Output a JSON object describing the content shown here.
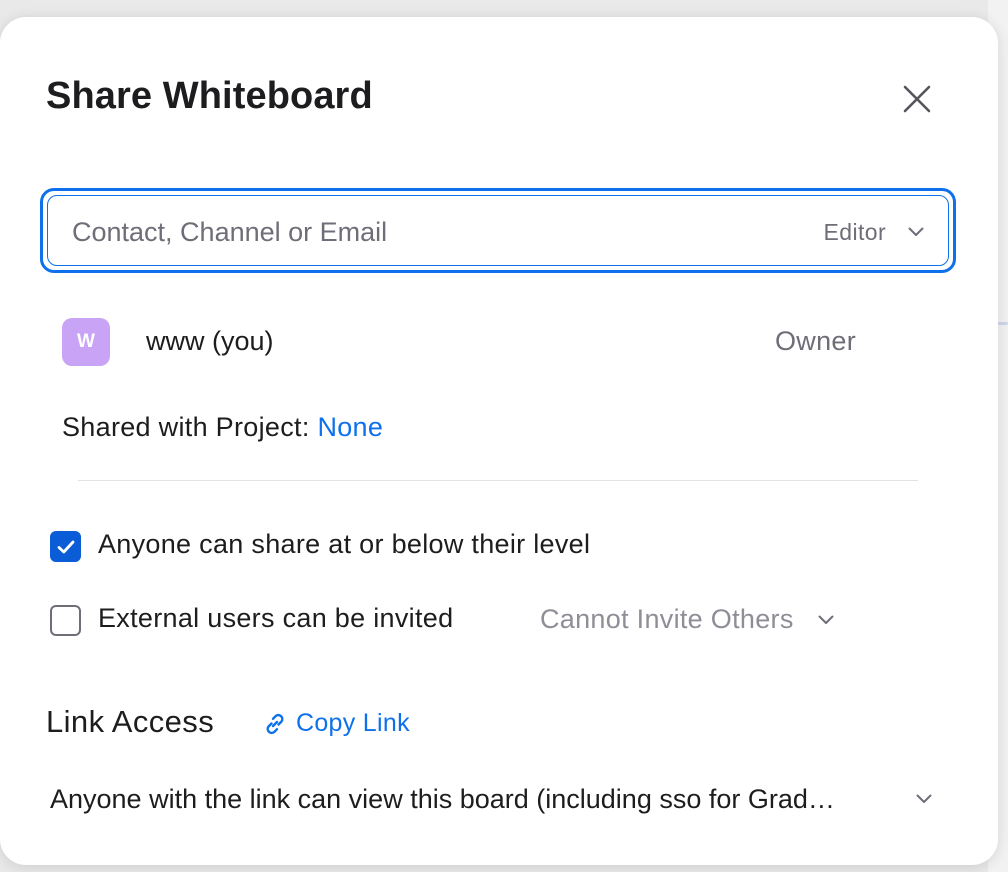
{
  "dialog": {
    "title": "Share Whiteboard",
    "close_icon": "close-icon"
  },
  "invite": {
    "placeholder": "Contact, Channel or Email",
    "value": "",
    "role": "Editor",
    "role_icon": "chevron-down-icon"
  },
  "members": [
    {
      "avatar_initial": "W",
      "avatar_color": "#c9a3f5",
      "name": "www (you)",
      "role": "Owner"
    }
  ],
  "project": {
    "label": "Shared with Project:",
    "value": "None"
  },
  "options": {
    "share_below_level": {
      "label": "Anyone can share at or below their level",
      "checked": true
    },
    "external_invite": {
      "label": "External users can be invited",
      "checked": false,
      "select_value": "Cannot Invite Others"
    }
  },
  "link_access": {
    "title": "Link Access",
    "copy_link_label": "Copy Link",
    "copy_link_icon": "link-icon",
    "selected": "Anyone with the link can view this board (including sso for Grad…"
  },
  "colors": {
    "accent": "#0e71eb",
    "checkbox_checked": "#0b5cd7",
    "muted_text": "#6e6e78",
    "avatar": "#c9a3f5"
  }
}
